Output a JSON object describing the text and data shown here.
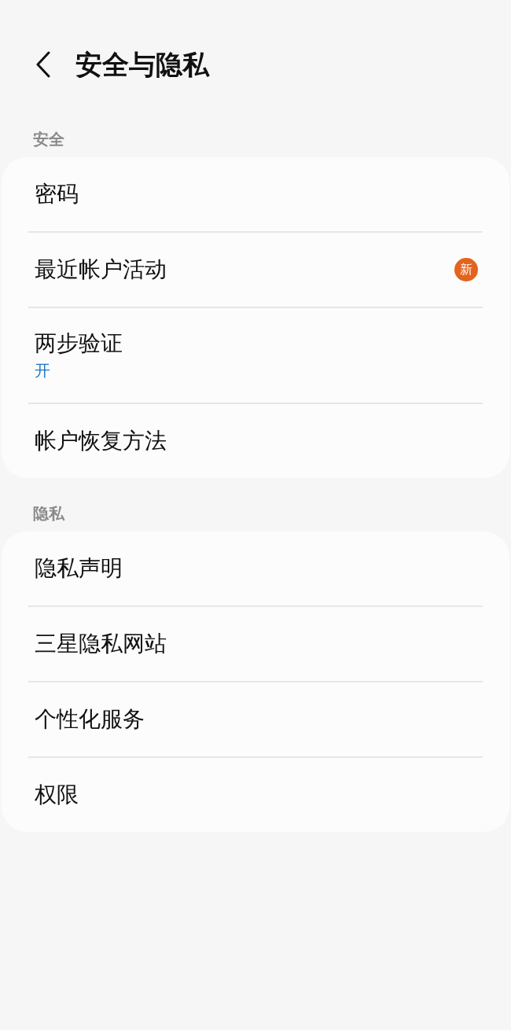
{
  "header": {
    "title": "安全与隐私"
  },
  "sections": [
    {
      "title": "安全",
      "items": [
        {
          "label": "密码"
        },
        {
          "label": "最近帐户活动",
          "badge": "新"
        },
        {
          "label": "两步验证",
          "subtitle": "开"
        },
        {
          "label": "帐户恢复方法"
        }
      ]
    },
    {
      "title": "隐私",
      "items": [
        {
          "label": "隐私声明"
        },
        {
          "label": "三星隐私网站"
        },
        {
          "label": "个性化服务"
        },
        {
          "label": "权限"
        }
      ]
    }
  ]
}
